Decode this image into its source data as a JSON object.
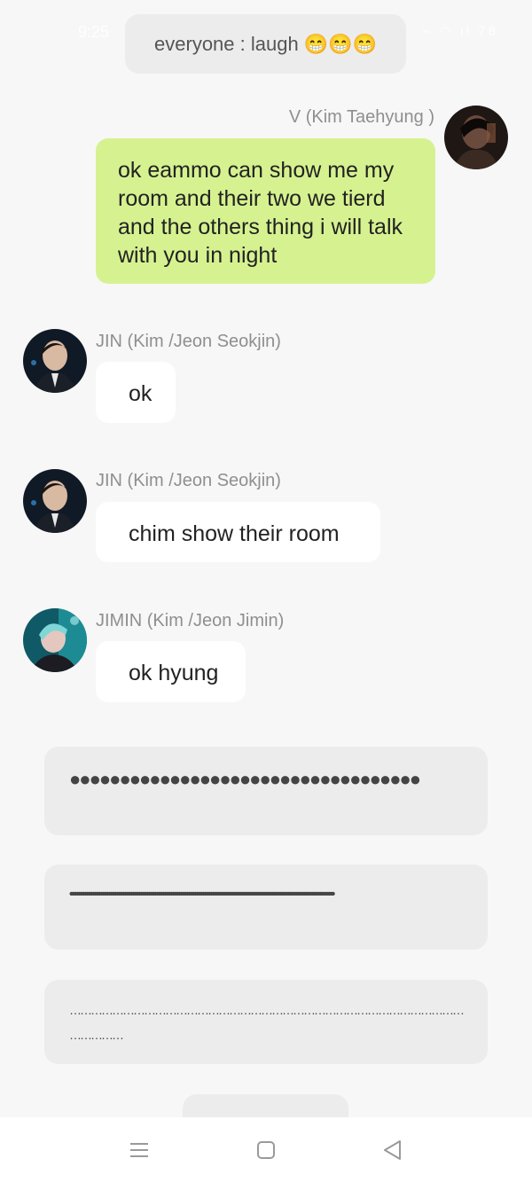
{
  "status_bar": {
    "time": "9:25",
    "icons_text": "⌁ ◠ ıl 78"
  },
  "narration_top": {
    "text": "everyone : laugh 😁😁😁"
  },
  "messages": [
    {
      "sender": "V (Kim Taehyung )",
      "text": "ok eammo can show me my room and their two we tierd and the others thing i will talk with you in night",
      "side": "right",
      "avatar_icon": "avatar-v-icon"
    },
    {
      "sender": "JIN (Kim /Jeon Seokjin)",
      "text": "ok",
      "side": "left",
      "avatar_icon": "avatar-jin-icon"
    },
    {
      "sender": "JIN (Kim /Jeon Seokjin)",
      "text": "chim show their room",
      "side": "left",
      "avatar_icon": "avatar-jin-icon"
    },
    {
      "sender": "JIMIN (Kim /Jeon Jimin)",
      "text": "ok hyung",
      "side": "left",
      "avatar_icon": "avatar-jimin-icon"
    }
  ],
  "dot_boxes": [
    {
      "text": "●●●●●●●●●●●●●●●●●●●●●●●●●●●●●●●●●●●"
    },
    {
      "text": "••••••••••••••••••••••••••••••••••••••••••••••••••••••••••••••••••••••••••••••••••••••••••••••••••••••••••••••••••••••••••••••••••••"
    },
    {
      "text": "………………………………………………………………………………………………………………"
    }
  ],
  "colors": {
    "background": "#f7f7f7",
    "self_bubble": "#d6f290",
    "other_bubble": "#ffffff",
    "narration_bg": "#ececec",
    "sender_text": "#8f8f8f"
  },
  "nav_bar": {
    "icons": [
      "menu-icon",
      "home-square-icon",
      "back-triangle-icon"
    ]
  }
}
